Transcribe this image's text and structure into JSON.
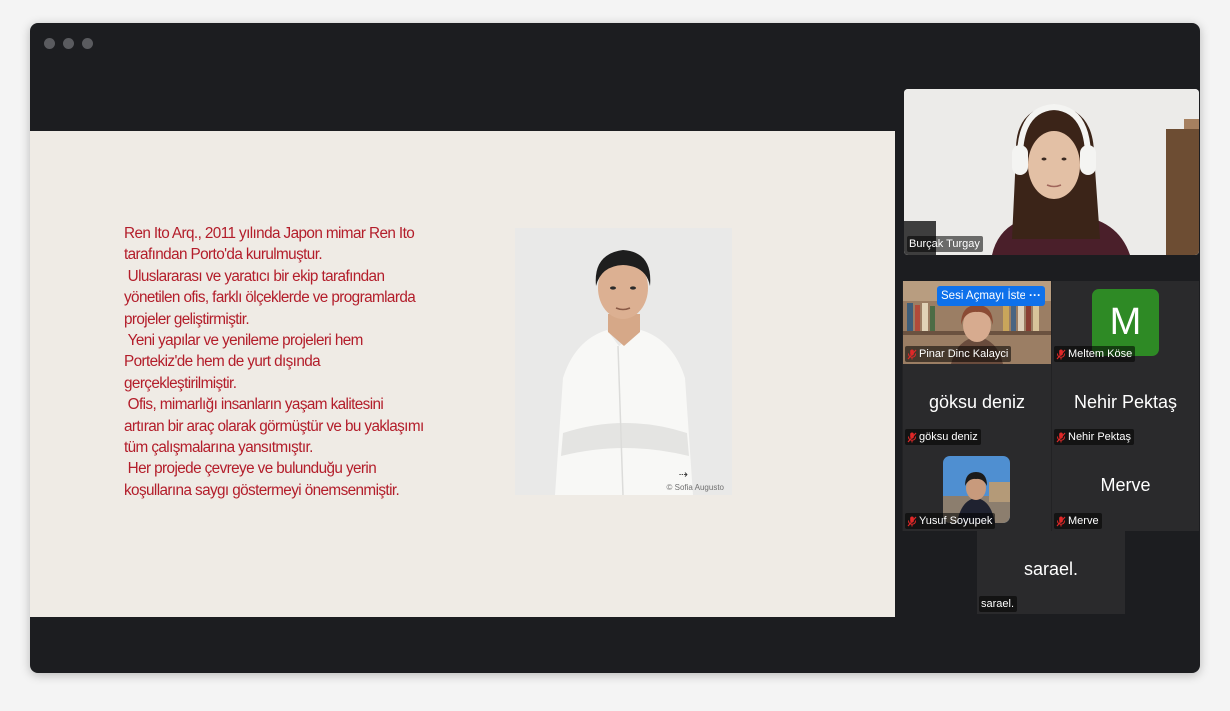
{
  "slide": {
    "text": "Ren Ito Arq., 2011 yılında Japon mimar Ren Ito tarafından Porto'da kurulmuştur.\n Uluslararası ve yaratıcı bir ekip tarafından yönetilen ofis, farklı ölçeklerde ve programlarda projeler geliştirmiştir.\n Yeni yapılar ve yenileme projeleri hem Portekiz'de hem de yurt dışında gerçekleştirilmiştir.\n Ofis, mimarlığı insanların yaşam kalitesini artıran bir araç olarak görmüştür ve bu yaklaşımı tüm çalışmalarına yansıtmıştır.\n Her projede çevreye ve bulunduğu yerin koşullarına saygı göstermeyi önemsenmiştir.",
    "photo_credit": "© Sofia Augusto",
    "photo_arrow_icon": "arrow-right-icon"
  },
  "speaker": {
    "name": "Burçak Turgay"
  },
  "participants": {
    "pinar": {
      "name": "Pinar Dinc Kalayci",
      "unmute_label": "Sesi Açmayı İste",
      "more_label": "···"
    },
    "meltem": {
      "name": "Meltem Köse",
      "avatar_letter": "M",
      "avatar_color": "#2e8a25"
    },
    "goksu": {
      "display": "göksu deniz",
      "name": "göksu deniz"
    },
    "nehir": {
      "display": "Nehir Pektaş",
      "name": "Nehir Pektaş"
    },
    "yusuf": {
      "name": "Yusuf Soyupek"
    },
    "merve": {
      "display": "Merve",
      "name": "Merve"
    },
    "sarael": {
      "display": "sarael.",
      "name": "sarael."
    }
  },
  "colors": {
    "slide_text": "#b31d2a",
    "accent_button": "#0e71eb",
    "mic_muted": "#e02828"
  }
}
